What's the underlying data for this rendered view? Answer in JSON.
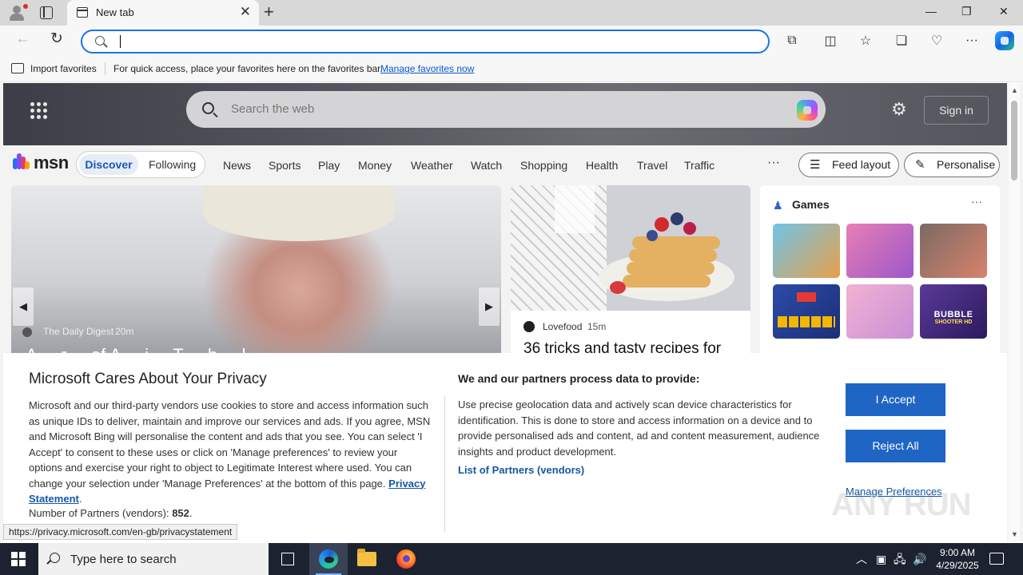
{
  "browser": {
    "tab_title": "New tab",
    "address_value": "",
    "tab_close_glyph": "✕",
    "new_tab_glyph": "+",
    "window_controls": {
      "minimize": "—",
      "maximize": "❐",
      "close": "✕"
    },
    "nav": {
      "back": "←",
      "refresh": "↻"
    },
    "toolbar_icons": [
      "extensions-icon",
      "split-screen-icon",
      "favorites-star-icon",
      "collections-icon",
      "browser-essentials-icon",
      "more-menu-icon",
      "copilot-icon"
    ],
    "toolbar_glyphs": {
      "extensions": "⧉",
      "split": "◫",
      "favorite": "☆",
      "collections": "❏",
      "essentials": "♡",
      "more": "···"
    }
  },
  "favorites_bar": {
    "import_label": "Import favorites",
    "message": "For quick access, place your favorites here on the favorites bar.",
    "manage_link": "Manage favorites now"
  },
  "msn": {
    "search_placeholder": "Search the web",
    "sign_in": "Sign in",
    "gear_glyph": "⚙",
    "brand": "msn",
    "tabs": {
      "discover": "Discover",
      "following": "Following"
    },
    "nav_links": [
      "News",
      "Sports",
      "Play",
      "Money",
      "Weather",
      "Watch",
      "Shopping",
      "Health",
      "Travel",
      "Traffic"
    ],
    "more_glyph": "···",
    "feed_layout": "Feed layout",
    "personalise": "Personalise",
    "feed_layout_glyph": "☰",
    "personalise_glyph": "✎",
    "logo_colors": [
      "#2a6df4",
      "#7b4dff",
      "#e63b6f",
      "#f7a400"
    ]
  },
  "cards": {
    "main": {
      "source": "The Daily Digest",
      "age": "20m",
      "headline": "A ... r ... of A ... i ... T ... h ... l",
      "prev_glyph": "◀",
      "next_glyph": "▶"
    },
    "food": {
      "source": "Lovefood",
      "age": "15m",
      "headline": "36 tricks and tasty recipes for"
    }
  },
  "games": {
    "title": "Games",
    "icon_glyph": "♟",
    "more_glyph": "···",
    "tiles": [
      {
        "colors": [
          "#6fc4e8",
          "#e8a04a"
        ]
      },
      {
        "colors": [
          "#e77fb6",
          "#9d56c9"
        ]
      },
      {
        "colors": [
          "#7a6a64",
          "#d9826b"
        ]
      },
      {
        "colors": [
          "#2b4ba8",
          "#1d2f78"
        ]
      },
      {
        "colors": [
          "#f2b2d2",
          "#c88fd6"
        ]
      },
      {
        "label": "BUBBLE",
        "label2": "SHOOTER HD",
        "colors": [
          "#5a3a9a",
          "#2c1a5c"
        ]
      }
    ]
  },
  "privacy": {
    "title": "Microsoft Cares About Your Privacy",
    "body": "Microsoft and our third-party vendors use cookies to store and access information such as unique IDs to deliver, maintain and improve our services and ads. If you agree, MSN and Microsoft Bing will personalise the content and ads that you see. You can select 'I Accept' to consent to these uses or click on 'Manage preferences' to review your options and exercise your right to object to Legitimate Interest where used.  You can change your selection under 'Manage Preferences' at the bottom of this page.",
    "privacy_link": "Privacy Statement",
    "partners_label": "Number of Partners (vendors):",
    "partners_count": "852",
    "right_title": "We and our partners process data to provide:",
    "right_body": "Use precise geolocation data and actively scan device characteristics for identification. This is done to store and access information on a device and to provide personalised ads and content, ad and content measurement, audience insights and product development.",
    "list_link": "List of Partners (vendors)",
    "accept": "I Accept",
    "reject": "Reject All",
    "manage": "Manage Preferences",
    "watermark": "ANY RUN"
  },
  "status_url": "https://privacy.microsoft.com/en-gb/privacystatement",
  "taskbar": {
    "search_placeholder": "Type here to search",
    "time": "9:00 AM",
    "date": "4/29/2025",
    "tray_glyphs": {
      "chevron": "︿",
      "battery": "▣",
      "network": "🖧",
      "volume": "🔊"
    }
  }
}
